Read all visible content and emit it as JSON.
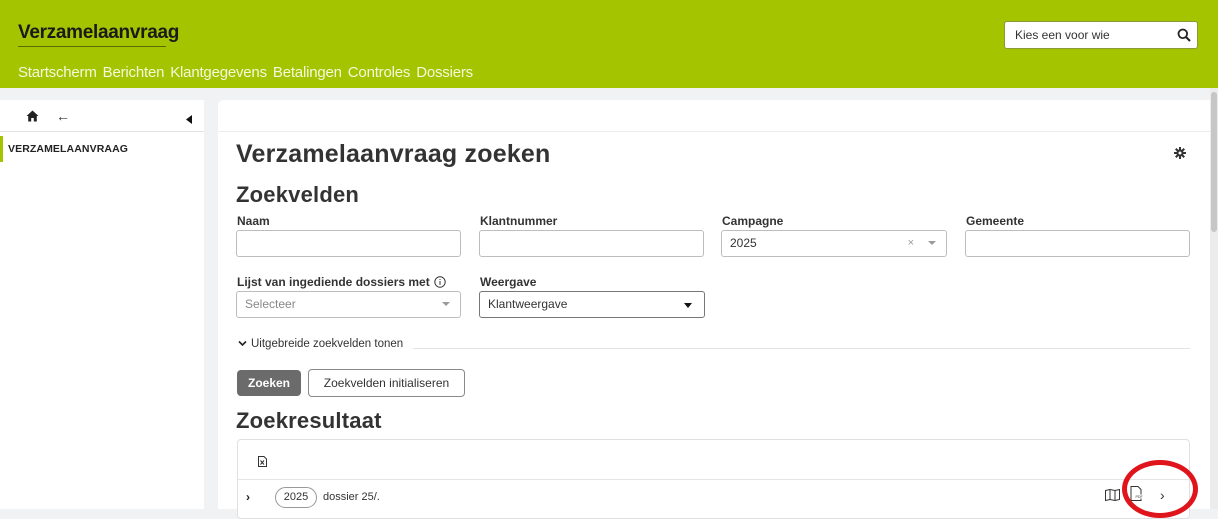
{
  "header": {
    "app_title": "Verzamelaanvraag",
    "search_placeholder": "Kies een voor wie",
    "brand_color": "#a4c400"
  },
  "mainnav": [
    "Startscherm",
    "Berichten",
    "Klantgegevens",
    "Betalingen",
    "Controles",
    "Dossiers"
  ],
  "sidebar": {
    "items": [
      {
        "label": "VERZAMELAANVRAAG",
        "active": true
      }
    ]
  },
  "main": {
    "page_title": "Verzamelaanvraag zoeken",
    "search_section_title": "Zoekvelden",
    "fields": {
      "naam": {
        "label": "Naam",
        "value": ""
      },
      "klantnummer": {
        "label": "Klantnummer",
        "value": ""
      },
      "campagne": {
        "label": "Campagne",
        "value": "2025"
      },
      "gemeente": {
        "label": "Gemeente",
        "value": ""
      },
      "ingediende": {
        "label": "Lijst van ingediende dossiers met",
        "placeholder": "Selecteer"
      },
      "weergave": {
        "label": "Weergave",
        "value": "Klantweergave"
      }
    },
    "advanced_toggle": "Uitgebreide zoekvelden tonen",
    "buttons": {
      "search": "Zoeken",
      "reset": "Zoekvelden initialiseren"
    },
    "results_title": "Zoekresultaat",
    "results": [
      {
        "year": "2025",
        "text": "dossier 25/."
      }
    ]
  },
  "highlight_color": "#e0141b"
}
